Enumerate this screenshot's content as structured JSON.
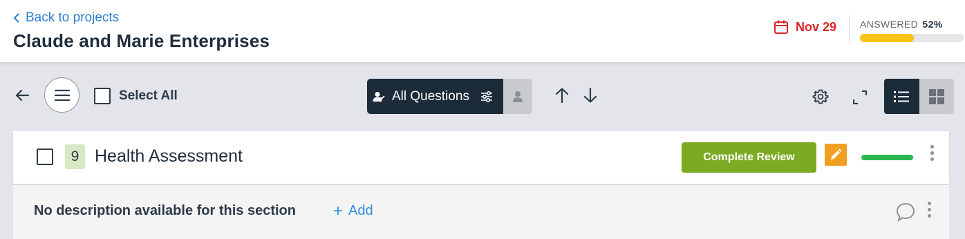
{
  "header": {
    "back_label": "Back to projects",
    "project_title": "Claude and Marie Enterprises",
    "due_date": "Nov 29",
    "answered_label": "ANSWERED",
    "answered_percent": "52%",
    "answered_fraction": 0.52,
    "accent_color": "#f5c518",
    "due_color": "#d9252b"
  },
  "toolbar": {
    "select_all_label": "Select All",
    "filter_label": "All Questions",
    "filter_bg": "#1c2b3a"
  },
  "section": {
    "count": "9",
    "title": "Health Assessment",
    "complete_button_label": "Complete Review",
    "complete_button_color": "#7aab23",
    "progress_fraction": 1.0,
    "progress_color": "#29b84f"
  },
  "description": {
    "text": "No description available for this section",
    "add_label": "Add"
  },
  "icons": [
    "chevron-left-icon",
    "calendar-icon",
    "arrow-left-icon",
    "hamburger-menu-icon",
    "user-filter-icon",
    "sliders-icon",
    "user-icon",
    "arrow-up-icon",
    "arrow-down-icon",
    "gear-icon",
    "expand-icon",
    "list-view-icon",
    "grid-view-icon",
    "pencil-icon",
    "kebab-menu-icon",
    "comment-icon"
  ]
}
